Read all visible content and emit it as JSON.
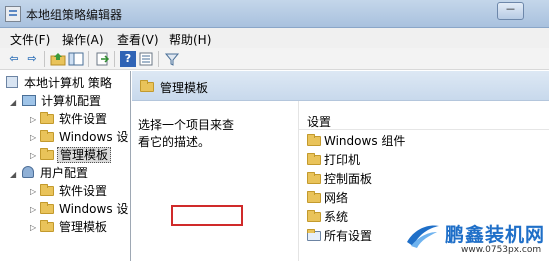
{
  "window": {
    "title": "本地组策略编辑器",
    "minimize": "－"
  },
  "menu": [
    "文件(F)",
    "操作(A)",
    "查看(V)",
    "帮助(H)"
  ],
  "toolbar": {
    "back": "⇦",
    "forward": "⇨",
    "up_folder": "folder-up-icon",
    "show_hide_tree": "pane-icon",
    "export": "export-icon",
    "help": "?",
    "view": "view-icon",
    "filter": "filter-icon"
  },
  "tree": {
    "root": "本地计算机 策略",
    "computer": {
      "label": "计算机配置",
      "children": [
        "软件设置",
        "Windows 设",
        "管理模板"
      ]
    },
    "user": {
      "label": "用户配置",
      "children": [
        "软件设置",
        "Windows 设",
        "管理模板"
      ]
    },
    "selected": "管理模板"
  },
  "content": {
    "header_title": "管理模板",
    "description": "选择一个项目来查看它的描述。",
    "column_header": "设置",
    "items": [
      "Windows 组件",
      "打印机",
      "控制面板",
      "网络",
      "系统",
      "所有设置"
    ],
    "highlighted_item": "系统",
    "highlight_color": "#d02a2a"
  },
  "watermark": {
    "brand": "鹏鑫装机网",
    "url": "www.0753px.com",
    "color": "#1f6fc8"
  }
}
